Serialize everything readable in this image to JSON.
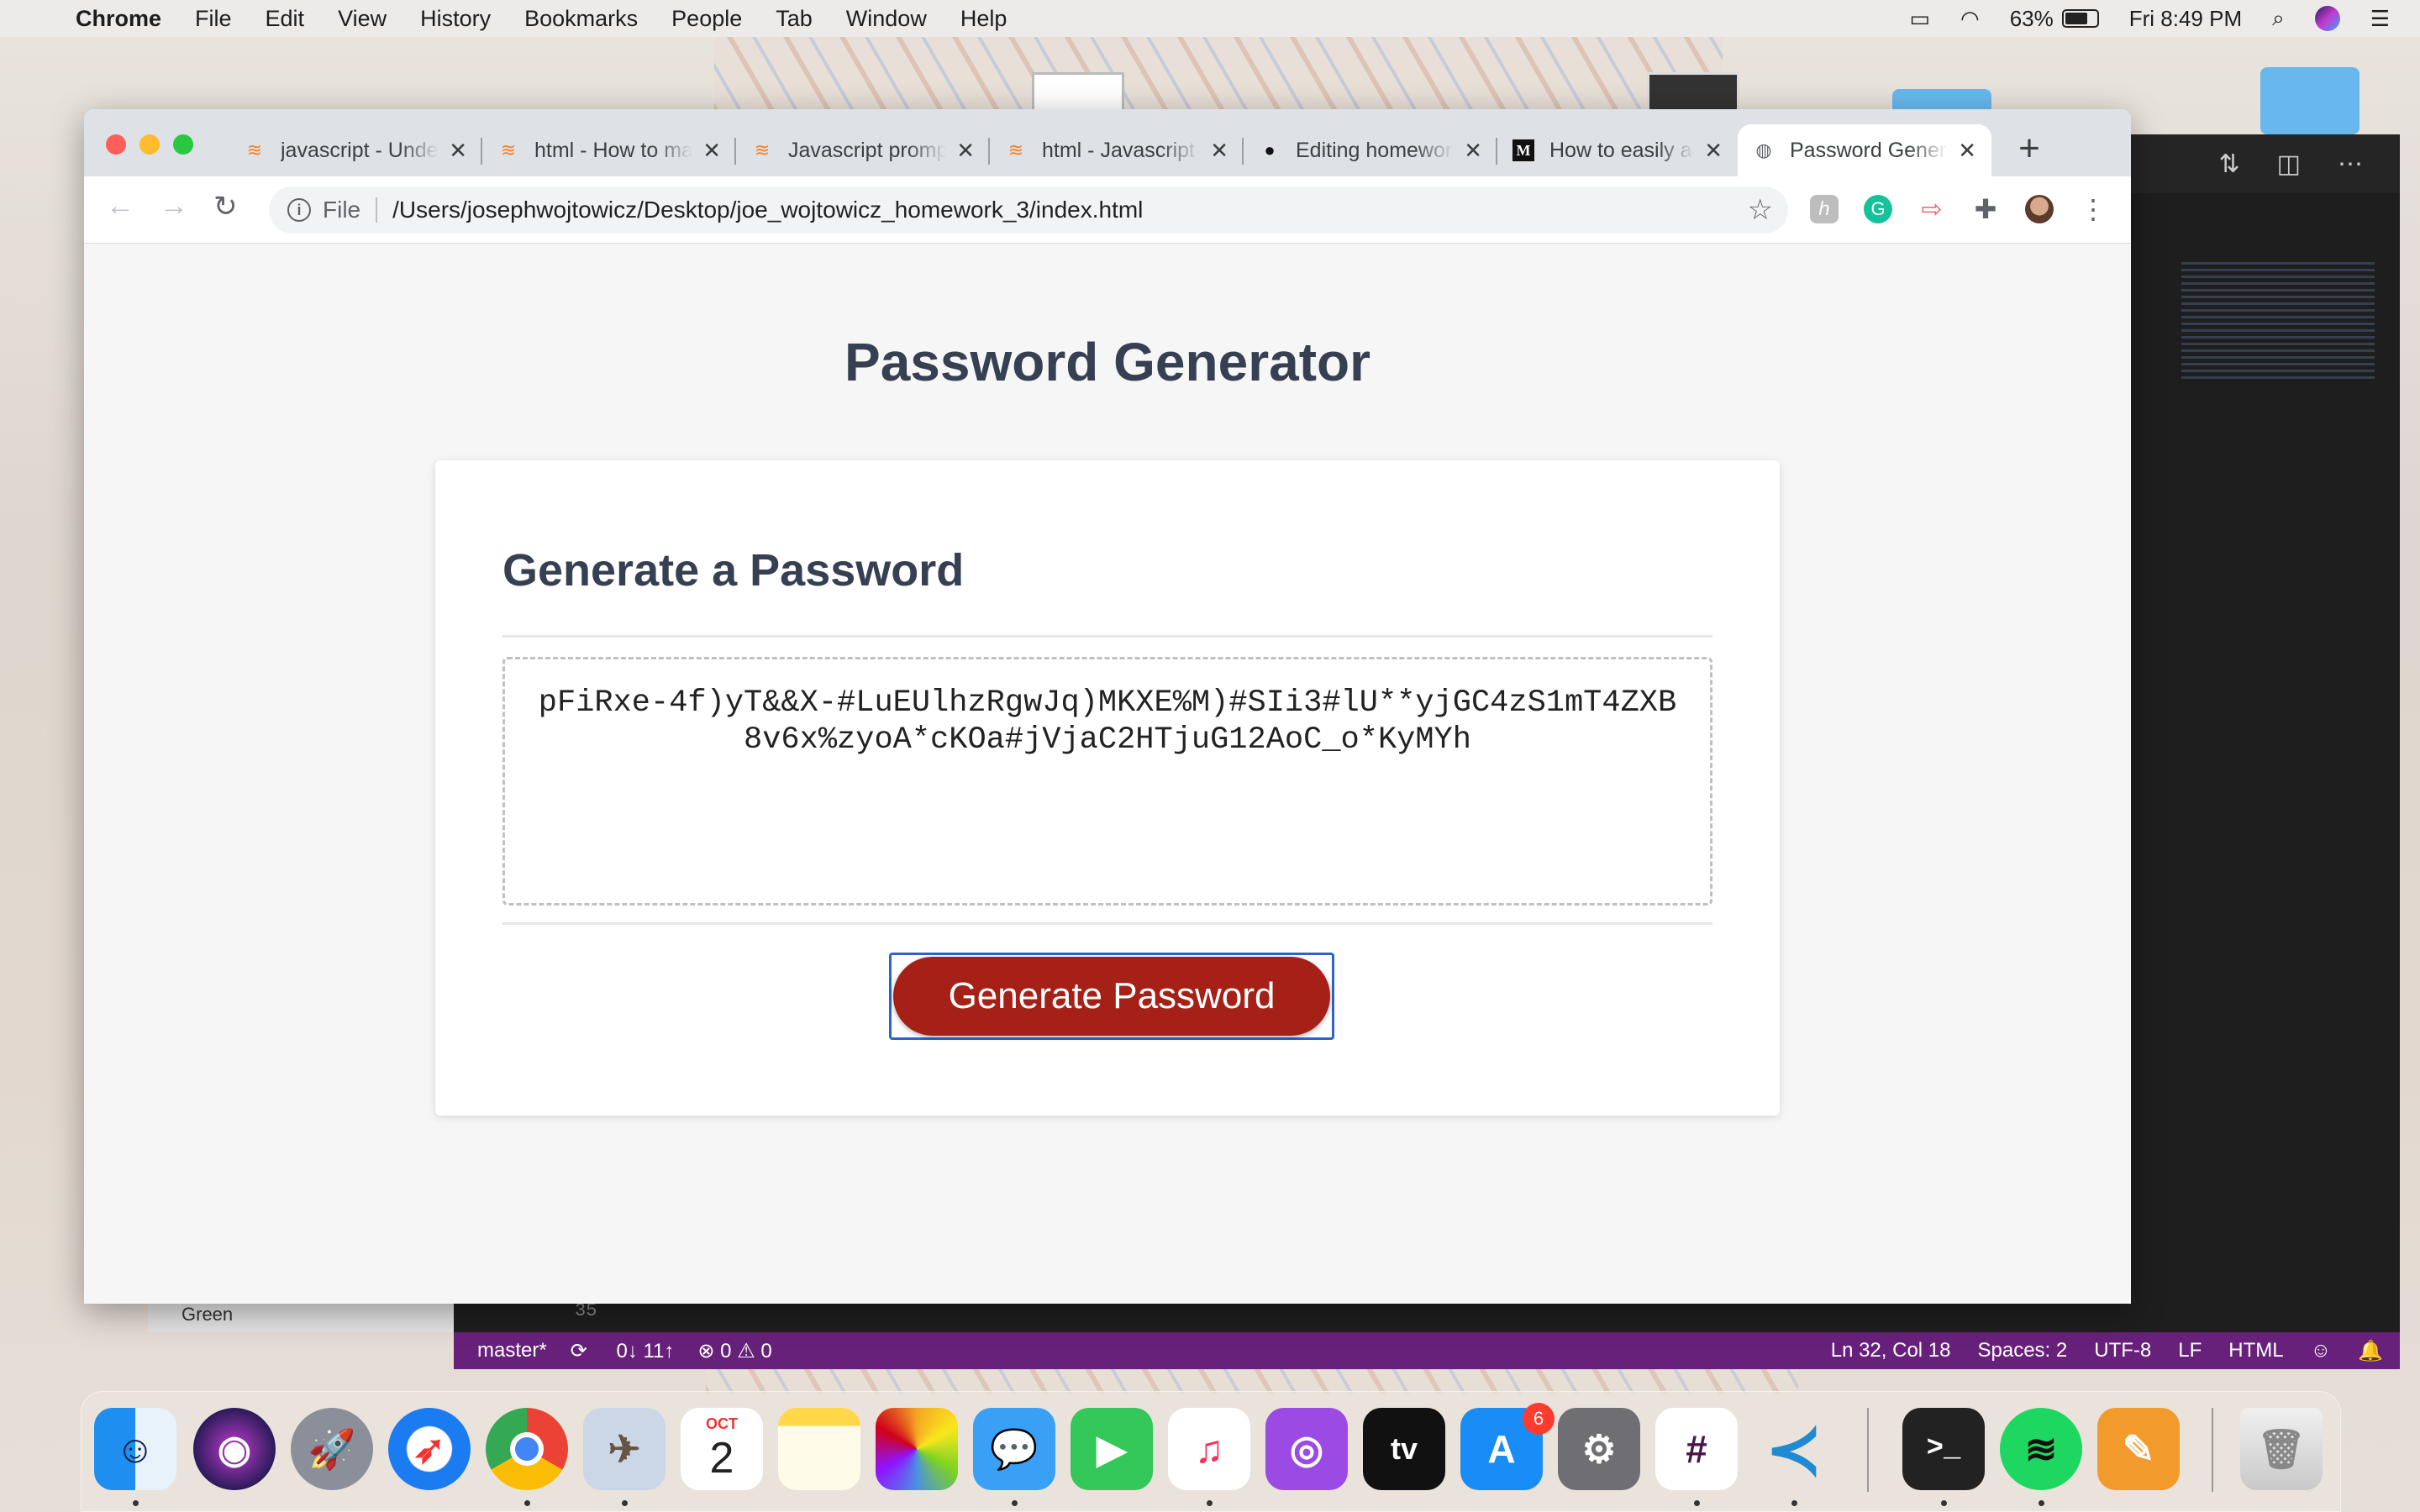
{
  "menubar": {
    "app": "Chrome",
    "items": [
      "File",
      "Edit",
      "View",
      "History",
      "Bookmarks",
      "People",
      "Tab",
      "Window",
      "Help"
    ],
    "battery": "63%",
    "clock": "Fri 8:49 PM"
  },
  "browser": {
    "tabs": [
      {
        "title": "javascript - Undefined",
        "icon": "stackoverflow-icon"
      },
      {
        "title": "html - How to make",
        "icon": "stackoverflow-icon"
      },
      {
        "title": "Javascript prompt",
        "icon": "stackoverflow-icon"
      },
      {
        "title": "html - Javascript",
        "icon": "stackoverflow-icon"
      },
      {
        "title": "Editing homework",
        "icon": "github-icon"
      },
      {
        "title": "How to easily add",
        "icon": "medium-icon"
      },
      {
        "title": "Password Generator",
        "icon": "globe-icon"
      }
    ],
    "active_tab": 6,
    "url_scheme": "File",
    "url": "/Users/josephwojtowicz/Desktop/joe_wojtowicz_homework_3/index.html"
  },
  "page": {
    "title": "Password Generator",
    "card_heading": "Generate a Password",
    "password": "pFiRxe-4f)yT&&X-#LuEUlhzRgwJq)MKXE%M)#SIi3#lU**yjGC4zS1mT4ZXB8v6x%zyoA*cKOa#jVjaC2HTjuG12AoC_o*KyMYh",
    "button_label": "Generate Password"
  },
  "vscode": {
    "branch": "master*",
    "sync": "0↓ 11↑",
    "problems": "⊗ 0 ⚠ 0",
    "cursor": "Ln 32, Col 18",
    "spaces": "Spaces: 2",
    "encoding": "UTF-8",
    "eol": "LF",
    "language": "HTML",
    "line_number": "35",
    "sidebar_item": "Green"
  },
  "dock": {
    "calendar_month": "OCT",
    "calendar_day": "2",
    "appstore_badge": "6",
    "tv_label": "tv"
  },
  "colors": {
    "button": "#a52118",
    "heading": "#364052",
    "vscode_status": "#68217a",
    "focus_ring": "#2e63c9"
  }
}
